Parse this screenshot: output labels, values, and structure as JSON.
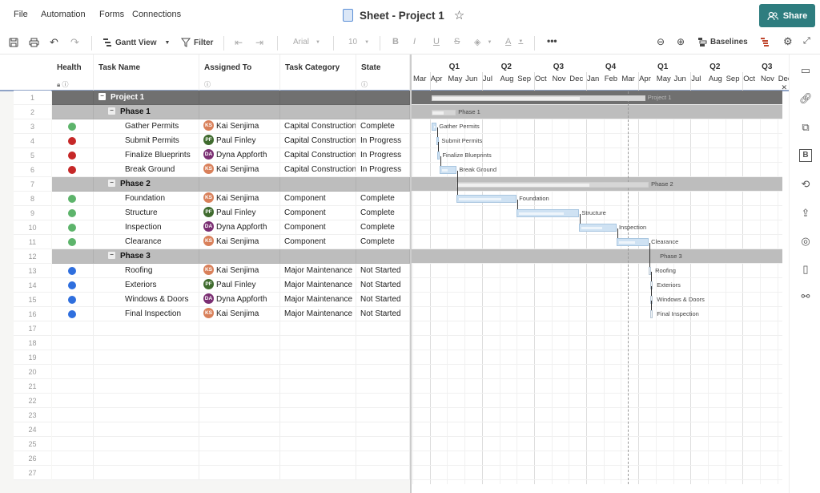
{
  "menu": [
    "File",
    "Automation",
    "Forms",
    "Connections"
  ],
  "title": "Sheet - Project 1",
  "share_label": "Share",
  "toolbar": {
    "gantt_view": "Gantt View",
    "filter": "Filter",
    "font": "Arial",
    "font_size": "10",
    "baselines": "Baselines"
  },
  "columns": [
    {
      "key": "health",
      "label": "Health",
      "icons": "lock-icon info-icon"
    },
    {
      "key": "task",
      "label": "Task Name",
      "icons": ""
    },
    {
      "key": "assigned",
      "label": "Assigned To",
      "icons": "info-icon"
    },
    {
      "key": "category",
      "label": "Task Category",
      "icons": ""
    },
    {
      "key": "state",
      "label": "State",
      "icons": "info-icon"
    }
  ],
  "colors": {
    "green": "#5db46b",
    "red": "#c62828",
    "blue": "#2f6fde",
    "ks": "#d9805a",
    "pf": "#3f6b2e",
    "da": "#7b2f73",
    "share": "#2e7d7f"
  },
  "rows": [
    {
      "n": "1",
      "type": "proj",
      "task": "Project 1"
    },
    {
      "n": "2",
      "type": "phase",
      "task": "Phase 1"
    },
    {
      "n": "3",
      "type": "task",
      "health": "green",
      "task": "Gather Permits",
      "initials": "KS",
      "assigned": "Kai Senjima",
      "category": "Capital Construction",
      "state": "Complete"
    },
    {
      "n": "4",
      "type": "task",
      "health": "red",
      "task": "Submit Permits",
      "initials": "PF",
      "assigned": "Paul Finley",
      "category": "Capital Construction",
      "state": "In Progress"
    },
    {
      "n": "5",
      "type": "task",
      "health": "red",
      "task": "Finalize Blueprints",
      "initials": "DA",
      "assigned": "Dyna Appforth",
      "category": "Capital Construction",
      "state": "In Progress"
    },
    {
      "n": "6",
      "type": "task",
      "health": "red",
      "task": "Break Ground",
      "initials": "KS",
      "assigned": "Kai Senjima",
      "category": "Capital Construction",
      "state": "In Progress"
    },
    {
      "n": "7",
      "type": "phase",
      "task": "Phase 2"
    },
    {
      "n": "8",
      "type": "task",
      "health": "green",
      "task": "Foundation",
      "initials": "KS",
      "assigned": "Kai Senjima",
      "category": "Component",
      "state": "Complete"
    },
    {
      "n": "9",
      "type": "task",
      "health": "green",
      "task": "Structure",
      "initials": "PF",
      "assigned": "Paul Finley",
      "category": "Component",
      "state": "Complete"
    },
    {
      "n": "10",
      "type": "task",
      "health": "green",
      "task": "Inspection",
      "initials": "DA",
      "assigned": "Dyna Appforth",
      "category": "Component",
      "state": "Complete"
    },
    {
      "n": "11",
      "type": "task",
      "health": "green",
      "task": "Clearance",
      "initials": "KS",
      "assigned": "Kai Senjima",
      "category": "Component",
      "state": "Complete"
    },
    {
      "n": "12",
      "type": "phase",
      "task": "Phase 3"
    },
    {
      "n": "13",
      "type": "task",
      "health": "blue",
      "task": "Roofing",
      "initials": "KS",
      "assigned": "Kai Senjima",
      "category": "Major Maintenance",
      "state": "Not Started"
    },
    {
      "n": "14",
      "type": "task",
      "health": "blue",
      "task": "Exteriors",
      "initials": "PF",
      "assigned": "Paul Finley",
      "category": "Major Maintenance",
      "state": "Not Started"
    },
    {
      "n": "15",
      "type": "task",
      "health": "blue",
      "task": "Windows & Doors",
      "initials": "DA",
      "assigned": "Dyna Appforth",
      "category": "Major Maintenance",
      "state": "Not Started"
    },
    {
      "n": "16",
      "type": "task",
      "health": "blue",
      "task": "Final Inspection",
      "initials": "KS",
      "assigned": "Kai Senjima",
      "category": "Major Maintenance",
      "state": "Not Started"
    },
    {
      "n": "17",
      "type": "empty"
    },
    {
      "n": "18",
      "type": "empty"
    },
    {
      "n": "19",
      "type": "empty"
    },
    {
      "n": "20",
      "type": "empty"
    },
    {
      "n": "21",
      "type": "empty"
    },
    {
      "n": "22",
      "type": "empty"
    },
    {
      "n": "23",
      "type": "empty"
    },
    {
      "n": "24",
      "type": "empty"
    },
    {
      "n": "25",
      "type": "empty"
    },
    {
      "n": "26",
      "type": "empty"
    },
    {
      "n": "27",
      "type": "empty"
    }
  ],
  "gantt": {
    "quarters": [
      "Q1",
      "Q2",
      "Q3",
      "Q4",
      "Q1",
      "Q2",
      "Q3"
    ],
    "months": [
      "Mar",
      "Apr",
      "May",
      "Jun",
      "Jul",
      "Aug",
      "Sep",
      "Oct",
      "Nov",
      "Dec",
      "Jan",
      "Feb",
      "Mar",
      "Apr",
      "May",
      "Jun",
      "Jul",
      "Aug",
      "Sep",
      "Oct",
      "Nov",
      "Dec"
    ],
    "today_month_index": 12.4,
    "bars": [
      {
        "row": 0,
        "label": "Project 1",
        "start": 1.1,
        "end": 13.4,
        "progress": 0.7,
        "summary": true
      },
      {
        "row": 1,
        "label": "Phase 1",
        "start": 1.1,
        "end": 2.5,
        "progress": 0.55,
        "summary": true
      },
      {
        "row": 2,
        "label": "Gather Permits",
        "start": 1.1,
        "end": 1.4,
        "progress": 1.0
      },
      {
        "row": 3,
        "label": "Submit Permits",
        "start": 1.4,
        "end": 1.5,
        "progress": 1.0
      },
      {
        "row": 4,
        "label": "Finalize Blueprints",
        "start": 1.45,
        "end": 1.55,
        "progress": 1.0
      },
      {
        "row": 5,
        "label": "Break Ground",
        "start": 1.55,
        "end": 2.55,
        "progress": 0.4
      },
      {
        "row": 6,
        "label": "Phase 2",
        "start": 2.55,
        "end": 13.6,
        "progress": 0.7,
        "summary": true
      },
      {
        "row": 7,
        "label": "Foundation",
        "start": 2.55,
        "end": 6.0,
        "progress": 0.75
      },
      {
        "row": 8,
        "label": "Structure",
        "start": 6.0,
        "end": 9.6,
        "progress": 0.75
      },
      {
        "row": 9,
        "label": "Inspection",
        "start": 9.6,
        "end": 11.75,
        "progress": 0.6
      },
      {
        "row": 10,
        "label": "Clearance",
        "start": 11.75,
        "end": 13.6,
        "progress": 0.55
      },
      {
        "row": 11,
        "label": "Phase 3",
        "start": 13.6,
        "end": 13.7,
        "progress": 0,
        "summary": true
      },
      {
        "row": 12,
        "label": "Roofing",
        "start": 13.6,
        "end": 13.7,
        "progress": 0
      },
      {
        "row": 13,
        "label": "Exteriors",
        "start": 13.7,
        "end": 13.8,
        "progress": 0
      },
      {
        "row": 14,
        "label": "Windows & Doors",
        "start": 13.7,
        "end": 13.8,
        "progress": 0
      },
      {
        "row": 15,
        "label": "Final Inspection",
        "start": 13.7,
        "end": 13.8,
        "progress": 0
      }
    ]
  }
}
